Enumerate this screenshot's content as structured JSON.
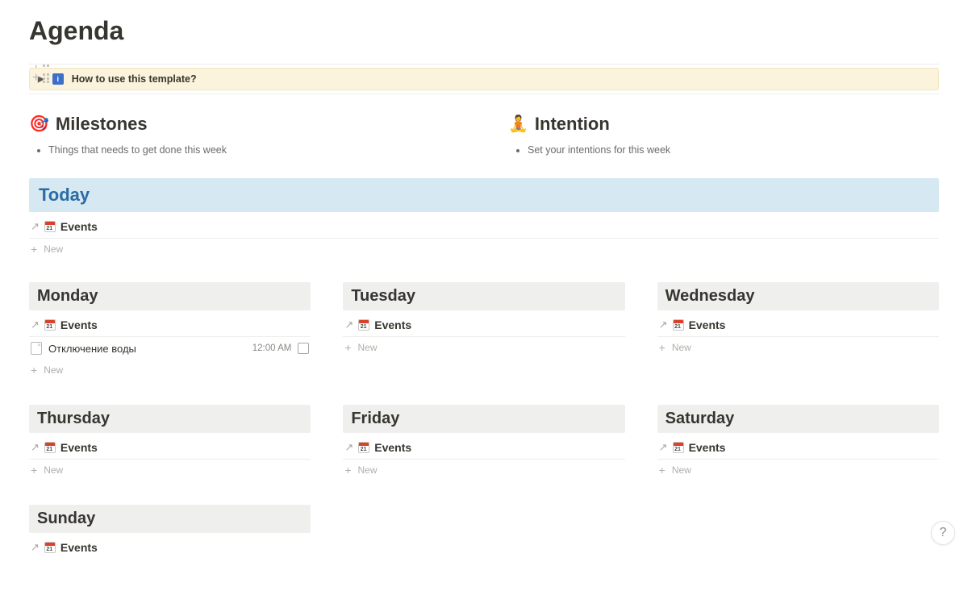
{
  "page_title": "Agenda",
  "callout": {
    "text": "How to use this template?"
  },
  "sections": {
    "milestones": {
      "icon": "🎯",
      "title": "Milestones",
      "bullets": [
        "Things that needs to get done this week"
      ]
    },
    "intention": {
      "icon": "🧘",
      "title": "Intention",
      "bullets": [
        "Set your intentions for this week"
      ]
    }
  },
  "today": {
    "title": "Today",
    "db_label": "Events"
  },
  "new_label": "New",
  "days": {
    "monday": {
      "title": "Monday",
      "db_label": "Events",
      "items": [
        {
          "title": "Отключение воды",
          "time": "12:00 AM"
        }
      ]
    },
    "tuesday": {
      "title": "Tuesday",
      "db_label": "Events"
    },
    "wednesday": {
      "title": "Wednesday",
      "db_label": "Events"
    },
    "thursday": {
      "title": "Thursday",
      "db_label": "Events"
    },
    "friday": {
      "title": "Friday",
      "db_label": "Events"
    },
    "saturday": {
      "title": "Saturday",
      "db_label": "Events"
    },
    "sunday": {
      "title": "Sunday",
      "db_label": "Events"
    }
  }
}
